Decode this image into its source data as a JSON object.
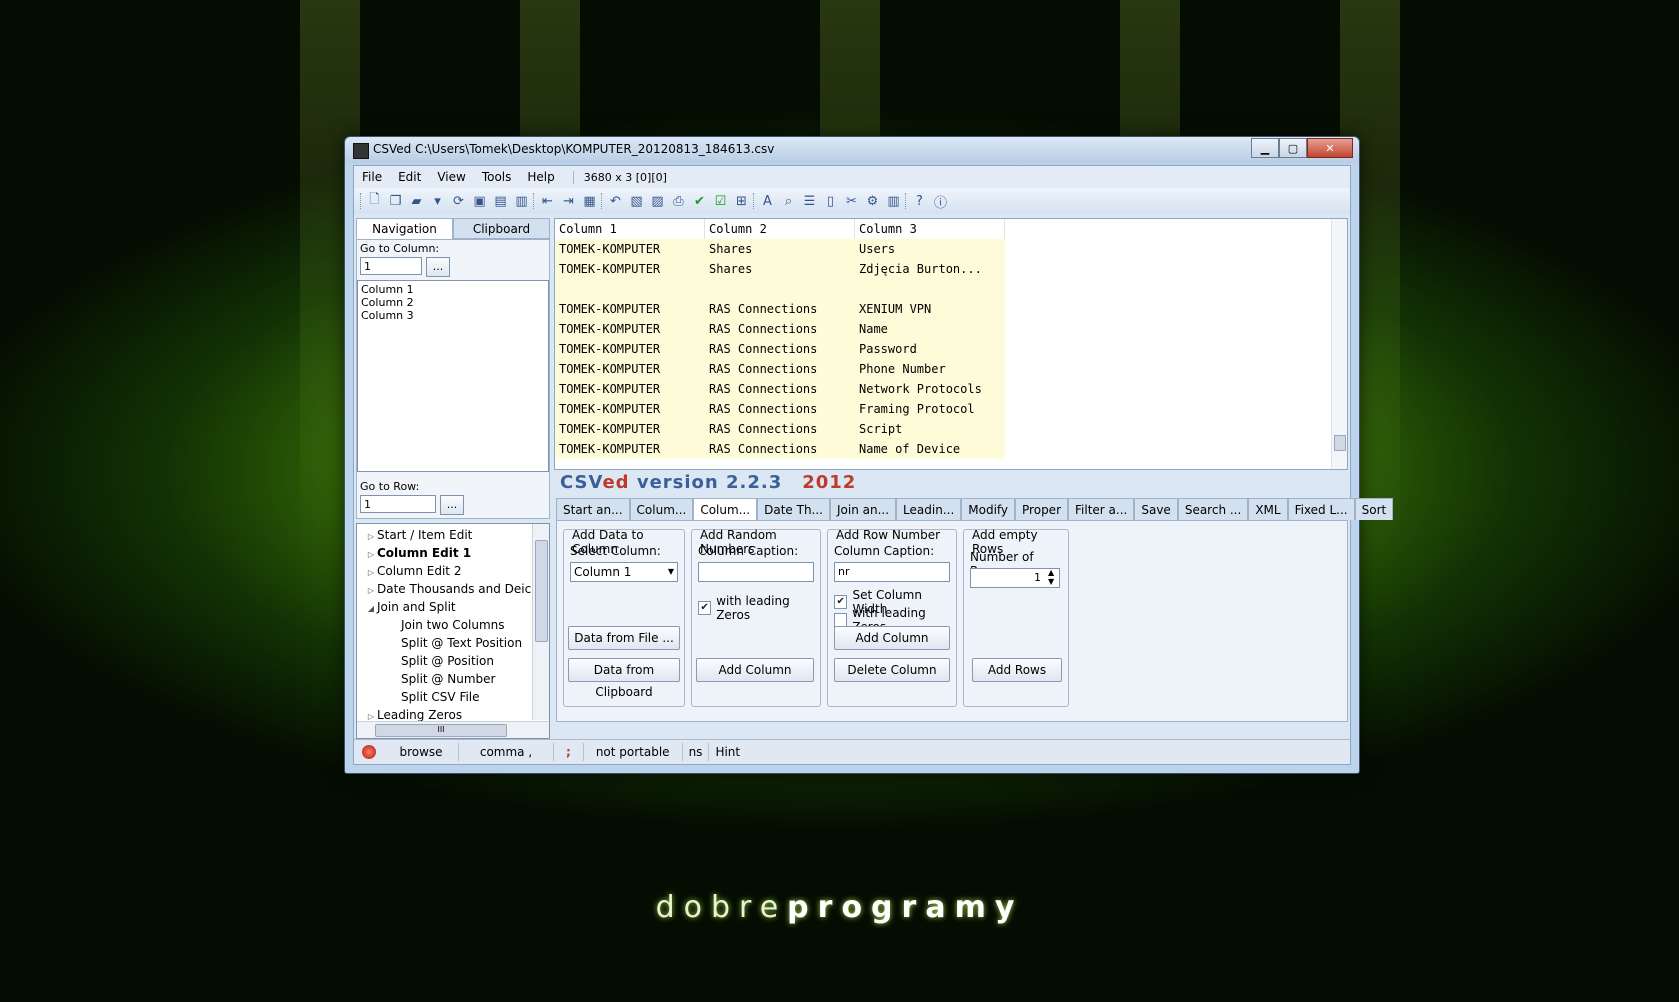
{
  "window": {
    "title": "CSVed C:\\Users\\Tomek\\Desktop\\KOMPUTER_20120813_184613.csv"
  },
  "menu": {
    "items": [
      "File",
      "Edit",
      "View",
      "Tools",
      "Help"
    ],
    "dims": "3680 x 3 [0][0]"
  },
  "left": {
    "tabs": [
      "Navigation",
      "Clipboard"
    ],
    "goto_column_label": "Go to Column:",
    "goto_column_value": "1",
    "goto_row_label": "Go to Row:",
    "goto_row_value": "1",
    "browse_btn": "...",
    "columns": [
      "Column 1",
      "Column 2",
      "Column 3"
    ],
    "tree": [
      {
        "label": "Start / Item Edit",
        "level": 0,
        "expand": "▷"
      },
      {
        "label": "Column Edit 1",
        "level": 0,
        "expand": "▷",
        "bold": true
      },
      {
        "label": "Column Edit 2",
        "level": 0,
        "expand": "▷"
      },
      {
        "label": "Date Thousands and Deicmal",
        "level": 0,
        "expand": "▷"
      },
      {
        "label": "Join and Split",
        "level": 0,
        "expand": "◢"
      },
      {
        "label": "Join two Columns",
        "level": 1
      },
      {
        "label": "Split @ Text Position",
        "level": 1
      },
      {
        "label": "Split @ Position",
        "level": 1
      },
      {
        "label": "Split @ Number",
        "level": 1
      },
      {
        "label": "Split CSV File",
        "level": 1
      },
      {
        "label": "Leading Zeros",
        "level": 0,
        "expand": "▷"
      }
    ],
    "hscroll_grip": "III"
  },
  "grid": {
    "headers": [
      "Column 1",
      "Column 2",
      "Column 3"
    ],
    "rows": [
      [
        "TOMEK-KOMPUTER",
        "Shares",
        "Users"
      ],
      [
        "TOMEK-KOMPUTER",
        "Shares",
        "Zdjęcia Burton..."
      ],
      [
        "",
        "",
        ""
      ],
      [
        "TOMEK-KOMPUTER",
        "RAS Connections",
        "XENIUM VPN"
      ],
      [
        "TOMEK-KOMPUTER",
        "RAS Connections",
        "Name"
      ],
      [
        "TOMEK-KOMPUTER",
        "RAS Connections",
        "Password"
      ],
      [
        "TOMEK-KOMPUTER",
        "RAS Connections",
        "Phone Number"
      ],
      [
        "TOMEK-KOMPUTER",
        "RAS Connections",
        "Network Protocols"
      ],
      [
        "TOMEK-KOMPUTER",
        "RAS Connections",
        "Framing Protocol"
      ],
      [
        "TOMEK-KOMPUTER",
        "RAS Connections",
        "Script"
      ],
      [
        "TOMEK-KOMPUTER",
        "RAS Connections",
        "Name of Device"
      ]
    ]
  },
  "banner": {
    "csv": "CSV",
    "ed": "ed",
    "version": " version 2.2.3",
    "year": "2012"
  },
  "tabs": [
    "Start an...",
    "Colum...",
    "Colum...",
    "Date Th...",
    "Join an...",
    "Leadin...",
    "Modify",
    "Proper",
    "Filter a...",
    "Save",
    "Search ...",
    "XML",
    "Fixed L...",
    "Sort"
  ],
  "panel": {
    "g1": {
      "title": "Add Data to Column",
      "select_label": "Select Column:",
      "select_value": "Column 1",
      "btn_file": "Data from File ...",
      "btn_clip": "Data from Clipboard"
    },
    "g2": {
      "title": "Add Random Numbers",
      "caption_label": "Column Caption:",
      "caption_value": "",
      "leading_zeros": "with leading Zeros",
      "btn_add": "Add Column"
    },
    "g3": {
      "title": "Add Row Number",
      "caption_label": "Column Caption:",
      "caption_value": "nr",
      "set_width": "Set Column Width",
      "leading_zeros": "with leading Zeros",
      "btn_add": "Add Column",
      "btn_delete": "Delete Column"
    },
    "g4": {
      "title": "Add empty Rows",
      "rows_label": "Number of Rows:",
      "rows_value": "1",
      "btn_add": "Add Rows"
    }
  },
  "status": [
    "browse",
    "comma ,",
    ";",
    "not portable",
    "ns",
    "Hint"
  ],
  "brand": {
    "light": "dobre",
    "bold": "programy"
  },
  "colors": {
    "accent": "#3a5f9a",
    "cell": "#fdfbd8",
    "status_dot": "#d0200f"
  }
}
